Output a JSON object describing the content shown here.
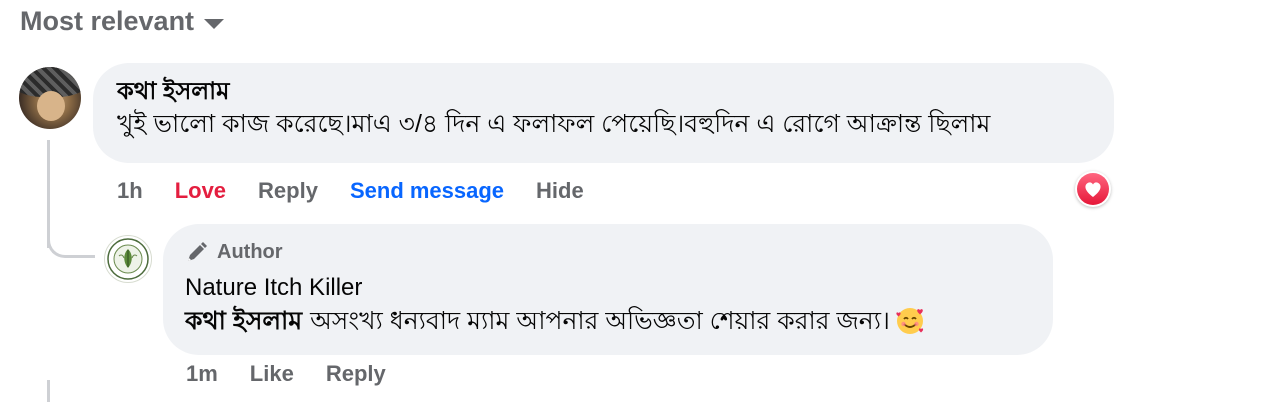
{
  "sort": {
    "label": "Most relevant",
    "caret_icon": "caret-down-icon"
  },
  "comment": {
    "author": "কথা ইসলাম",
    "text": "খুই ভালো কাজ করেছে।মাএ ৩/৪ দিন এ ফলাফল পেয়েছি।বহুদিন এ রোগে আক্রান্ত ছিলাম",
    "time": "1h",
    "actions": {
      "love": "Love",
      "reply": "Reply",
      "send_message": "Send message",
      "hide": "Hide"
    },
    "reaction_icon": "love-reaction-icon",
    "colors": {
      "love": "#e41e3f",
      "link": "#0866ff"
    }
  },
  "reply": {
    "badge": "Author",
    "badge_icon": "pen-icon",
    "author": "Nature Itch Killer",
    "mention": "কথা ইসলাম",
    "text": "অসংখ্য ধন্যবাদ ম্যাম আপনার অভিজ্ঞতা শেয়ার করার জন্য।",
    "emoji_icon": "smiling-face-with-hearts-icon",
    "time": "1m",
    "actions": {
      "like": "Like",
      "reply": "Reply"
    }
  },
  "colors": {
    "bubble": "#f0f2f5",
    "secondary_text": "#65676b",
    "thread_line": "#ced0d4"
  }
}
